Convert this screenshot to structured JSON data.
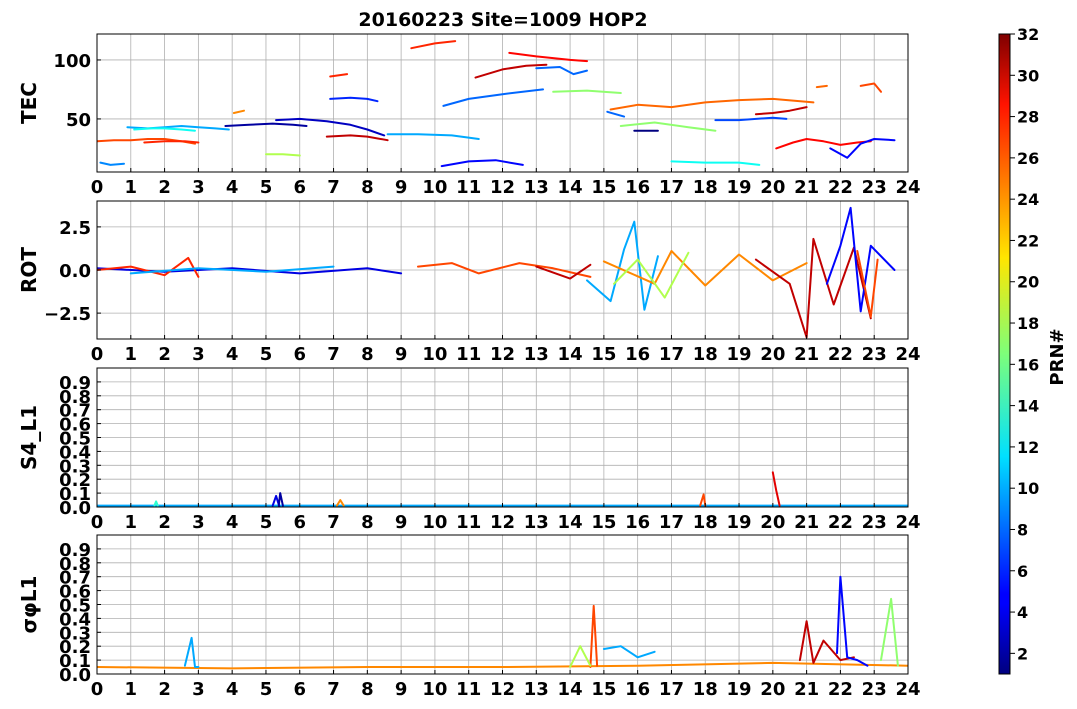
{
  "chart_data": {
    "title": "20160223 Site=1009 HOP2",
    "type": "line",
    "xlim": [
      0,
      24
    ],
    "x_ticks": [
      0,
      1,
      2,
      3,
      4,
      5,
      6,
      7,
      8,
      9,
      10,
      11,
      12,
      13,
      14,
      15,
      16,
      17,
      18,
      19,
      20,
      21,
      22,
      23,
      24
    ],
    "grid": true,
    "colorbar": {
      "label": "PRN#",
      "colormap": "jet",
      "range": [
        1,
        32
      ],
      "ticks": [
        2,
        4,
        6,
        8,
        10,
        12,
        14,
        16,
        18,
        20,
        22,
        24,
        26,
        28,
        30,
        32
      ]
    },
    "panels": [
      {
        "ylabel": "TEC",
        "ylim": [
          5,
          122
        ],
        "y_ticks": [
          50,
          100
        ],
        "y_tick_labels": [
          "50",
          "100"
        ],
        "series": [
          {
            "prn": 9,
            "x": [
              0.1,
              0.4,
              0.8
            ],
            "y": [
              13,
              11,
              12
            ]
          },
          {
            "prn": 26,
            "x": [
              0.0,
              0.5,
              1.0,
              1.5,
              2.0,
              2.5,
              2.9
            ],
            "y": [
              31,
              32,
              32,
              33,
              33,
              31,
              29
            ]
          },
          {
            "prn": 10,
            "x": [
              0.9,
              1.5,
              2.0,
              2.5,
              3.0,
              3.5,
              3.9
            ],
            "y": [
              43,
              42,
              43,
              44,
              43,
              42,
              41
            ]
          },
          {
            "prn": 13,
            "x": [
              1.1,
              1.6,
              2.0,
              2.5,
              2.9
            ],
            "y": [
              41,
              42,
              42,
              41,
              40
            ]
          },
          {
            "prn": 27,
            "x": [
              1.4,
              2.0,
              2.6,
              3.0
            ],
            "y": [
              30,
              31,
              31,
              30
            ]
          },
          {
            "prn": 24,
            "x": [
              4.05,
              4.35
            ],
            "y": [
              55,
              57
            ]
          },
          {
            "prn": 2,
            "x": [
              3.8,
              4.5,
              5.2,
              5.8,
              6.2
            ],
            "y": [
              44,
              45,
              46,
              45,
              44
            ]
          },
          {
            "prn": 18,
            "x": [
              5.0,
              5.5,
              6.0
            ],
            "y": [
              20,
              20,
              19
            ]
          },
          {
            "prn": 3,
            "x": [
              5.3,
              6.0,
              6.8,
              7.5,
              8.0,
              8.5
            ],
            "y": [
              49,
              50,
              48,
              45,
              41,
              36
            ]
          },
          {
            "prn": 6,
            "x": [
              6.9,
              7.5,
              8.0,
              8.3
            ],
            "y": [
              67,
              68,
              67,
              65
            ]
          },
          {
            "prn": 27,
            "x": [
              6.9,
              7.4
            ],
            "y": [
              86,
              88
            ]
          },
          {
            "prn": 30,
            "x": [
              6.8,
              7.5,
              8.0,
              8.6
            ],
            "y": [
              35,
              36,
              35,
              32
            ]
          },
          {
            "prn": 10,
            "x": [
              8.6,
              9.5,
              10.5,
              11.3
            ],
            "y": [
              37,
              37,
              36,
              33
            ]
          },
          {
            "prn": 27,
            "x": [
              9.3,
              10.0,
              10.6
            ],
            "y": [
              110,
              114,
              116
            ]
          },
          {
            "prn": 8,
            "x": [
              10.25,
              11.0,
              12.0,
              13.2
            ],
            "y": [
              61,
              67,
              71,
              75
            ]
          },
          {
            "prn": 5,
            "x": [
              10.2,
              11.0,
              11.8,
              12.6
            ],
            "y": [
              10,
              14,
              15,
              11
            ]
          },
          {
            "prn": 30,
            "x": [
              11.2,
              12.0,
              12.7,
              13.3
            ],
            "y": [
              85,
              92,
              95,
              96
            ]
          },
          {
            "prn": 28,
            "x": [
              12.2,
              13.0,
              14.0,
              14.5
            ],
            "y": [
              106,
              103,
              100,
              99
            ]
          },
          {
            "prn": 8,
            "x": [
              13.0,
              13.7,
              14.1,
              14.5
            ],
            "y": [
              93,
              94,
              88,
              91
            ]
          },
          {
            "prn": 17,
            "x": [
              13.5,
              14.5,
              15.5
            ],
            "y": [
              73,
              74,
              72
            ]
          },
          {
            "prn": 8,
            "x": [
              15.1,
              15.6
            ],
            "y": [
              56,
              52
            ]
          },
          {
            "prn": 25,
            "x": [
              15.2,
              16.0,
              17.0,
              18.0,
              19.0,
              20.0,
              21.2
            ],
            "y": [
              58,
              62,
              60,
              64,
              66,
              67,
              64
            ]
          },
          {
            "prn": 17,
            "x": [
              15.5,
              16.5,
              17.5,
              18.3
            ],
            "y": [
              44,
              47,
              43,
              40
            ]
          },
          {
            "prn": 1,
            "x": [
              15.9,
              16.6
            ],
            "y": [
              40,
              40
            ]
          },
          {
            "prn": 7,
            "x": [
              18.3,
              19.0,
              20.0,
              20.4
            ],
            "y": [
              49,
              49,
              51,
              50
            ]
          },
          {
            "prn": 13,
            "x": [
              17.0,
              18.0,
              19.0,
              19.6
            ],
            "y": [
              14,
              13,
              13,
              11
            ]
          },
          {
            "prn": 30,
            "x": [
              19.5,
              20.0,
              20.5,
              21.0
            ],
            "y": [
              54,
              55,
              57,
              60
            ]
          },
          {
            "prn": 28,
            "x": [
              20.1,
              20.6,
              21.0,
              21.5,
              22.0,
              22.5,
              22.9
            ],
            "y": [
              25,
              30,
              33,
              31,
              28,
              30,
              31
            ]
          },
          {
            "prn": 5,
            "x": [
              21.7,
              22.2,
              22.6,
              23.0,
              23.6
            ],
            "y": [
              25,
              17,
              29,
              33,
              32
            ]
          },
          {
            "prn": 25,
            "x": [
              21.3,
              21.6
            ],
            "y": [
              77,
              78
            ]
          },
          {
            "prn": 26,
            "x": [
              22.6,
              23.0,
              23.2
            ],
            "y": [
              78,
              80,
              73
            ]
          }
        ]
      },
      {
        "ylabel": "ROT",
        "ylim": [
          -4,
          4
        ],
        "y_ticks": [
          -2.5,
          0,
          2.5
        ],
        "y_tick_labels": [
          "−2.5",
          "0.0",
          "2.5"
        ],
        "series": [
          {
            "prn": 4,
            "x": [
              0.0,
              2.0,
              4.0,
              6.0,
              8.0,
              9.0
            ],
            "y": [
              0.1,
              -0.1,
              0.1,
              -0.2,
              0.1,
              -0.2
            ]
          },
          {
            "prn": 27,
            "x": [
              0.0,
              1.0,
              2.0,
              2.7,
              3.0
            ],
            "y": [
              0.0,
              0.2,
              -0.3,
              0.7,
              -0.4
            ]
          },
          {
            "prn": 10,
            "x": [
              1.0,
              3.0,
              5.0,
              7.0
            ],
            "y": [
              -0.2,
              0.1,
              -0.1,
              0.2
            ]
          },
          {
            "prn": 26,
            "x": [
              9.5,
              10.5,
              11.3,
              12.5,
              13.5,
              14.6
            ],
            "y": [
              0.2,
              0.4,
              -0.2,
              0.4,
              0.1,
              -0.4
            ]
          },
          {
            "prn": 30,
            "x": [
              13.0,
              14.0,
              14.6
            ],
            "y": [
              0.2,
              -0.5,
              0.3
            ]
          },
          {
            "prn": 10,
            "x": [
              14.5,
              15.2,
              15.6,
              15.9,
              16.2,
              16.6
            ],
            "y": [
              -0.6,
              -1.8,
              1.2,
              2.8,
              -2.3,
              0.8
            ]
          },
          {
            "prn": 24,
            "x": [
              15.0,
              16.5,
              17.0,
              18.0,
              19.0,
              20.0,
              21.0
            ],
            "y": [
              0.5,
              -0.8,
              1.1,
              -0.9,
              0.9,
              -0.6,
              0.4
            ]
          },
          {
            "prn": 18,
            "x": [
              15.3,
              16.0,
              16.8,
              17.5
            ],
            "y": [
              -0.8,
              0.6,
              -1.6,
              1.0
            ]
          },
          {
            "prn": 30,
            "x": [
              19.5,
              20.5,
              21.0,
              21.2,
              21.8,
              22.4,
              22.9
            ],
            "y": [
              0.6,
              -0.8,
              -3.9,
              1.8,
              -2.0,
              1.3,
              -2.8
            ]
          },
          {
            "prn": 5,
            "x": [
              21.6,
              22.0,
              22.3,
              22.6,
              22.9,
              23.6
            ],
            "y": [
              -0.8,
              1.4,
              3.6,
              -2.4,
              1.4,
              0.0
            ]
          },
          {
            "prn": 26,
            "x": [
              22.5,
              22.9,
              23.1
            ],
            "y": [
              1.1,
              -2.7,
              0.6
            ]
          }
        ]
      },
      {
        "ylabel": "S4_L1",
        "ylim": [
          0,
          1
        ],
        "y_ticks": [
          0.0,
          0.1,
          0.2,
          0.3,
          0.4,
          0.5,
          0.6,
          0.7,
          0.8,
          0.9
        ],
        "y_tick_labels": [
          "0.0",
          "0.1",
          "0.2",
          "0.3",
          "0.4",
          "0.5",
          "0.6",
          "0.7",
          "0.8",
          "0.9"
        ],
        "series": [
          {
            "prn": 10,
            "x": [
              0.0,
              24.0
            ],
            "y": [
              0.01,
              0.01
            ]
          },
          {
            "prn": 14,
            "x": [
              1.7,
              1.75,
              1.8
            ],
            "y": [
              0.01,
              0.04,
              0.01
            ]
          },
          {
            "prn": 4,
            "x": [
              5.2,
              5.3,
              5.4
            ],
            "y": [
              0.01,
              0.08,
              0.0
            ]
          },
          {
            "prn": 2,
            "x": [
              5.38,
              5.42,
              5.5
            ],
            "y": [
              0.01,
              0.1,
              0.01
            ]
          },
          {
            "prn": 24,
            "x": [
              7.1,
              7.2,
              7.3
            ],
            "y": [
              0.01,
              0.05,
              0.01
            ]
          },
          {
            "prn": 26,
            "x": [
              17.85,
              17.95,
              18.0
            ],
            "y": [
              0.01,
              0.09,
              0.01
            ]
          },
          {
            "prn": 29,
            "x": [
              20.0,
              20.1,
              20.2
            ],
            "y": [
              0.25,
              0.12,
              0.01
            ]
          }
        ]
      },
      {
        "ylabel": "σφL1",
        "ylim": [
          0,
          1
        ],
        "y_ticks": [
          0.0,
          0.1,
          0.2,
          0.3,
          0.4,
          0.5,
          0.6,
          0.7,
          0.8,
          0.9
        ],
        "y_tick_labels": [
          "0.0",
          "0.1",
          "0.2",
          "0.3",
          "0.4",
          "0.5",
          "0.6",
          "0.7",
          "0.8",
          "0.9"
        ],
        "series": [
          {
            "prn": 24,
            "x": [
              0.0,
              4.0,
              8.0,
              12.0,
              16.0,
              20.0,
              24.0
            ],
            "y": [
              0.05,
              0.04,
              0.05,
              0.05,
              0.06,
              0.08,
              0.06
            ]
          },
          {
            "prn": 10,
            "x": [
              2.6,
              2.8,
              2.9,
              3.0
            ],
            "y": [
              0.06,
              0.26,
              0.05,
              0.05
            ]
          },
          {
            "prn": 26,
            "x": [
              14.6,
              14.7,
              14.8
            ],
            "y": [
              0.05,
              0.49,
              0.06
            ]
          },
          {
            "prn": 10,
            "x": [
              15.0,
              15.5,
              16.0,
              16.5
            ],
            "y": [
              0.18,
              0.2,
              0.12,
              0.16
            ]
          },
          {
            "prn": 18,
            "x": [
              14.0,
              14.3,
              14.6
            ],
            "y": [
              0.05,
              0.2,
              0.06
            ]
          },
          {
            "prn": 30,
            "x": [
              20.8,
              21.0,
              21.2,
              21.5,
              22.0,
              22.4
            ],
            "y": [
              0.1,
              0.38,
              0.08,
              0.24,
              0.1,
              0.12
            ]
          },
          {
            "prn": 5,
            "x": [
              21.9,
              22.0,
              22.2,
              22.5,
              22.8
            ],
            "y": [
              0.15,
              0.7,
              0.12,
              0.1,
              0.06
            ]
          },
          {
            "prn": 17,
            "x": [
              23.2,
              23.5,
              23.7
            ],
            "y": [
              0.1,
              0.54,
              0.06
            ]
          }
        ]
      }
    ]
  }
}
